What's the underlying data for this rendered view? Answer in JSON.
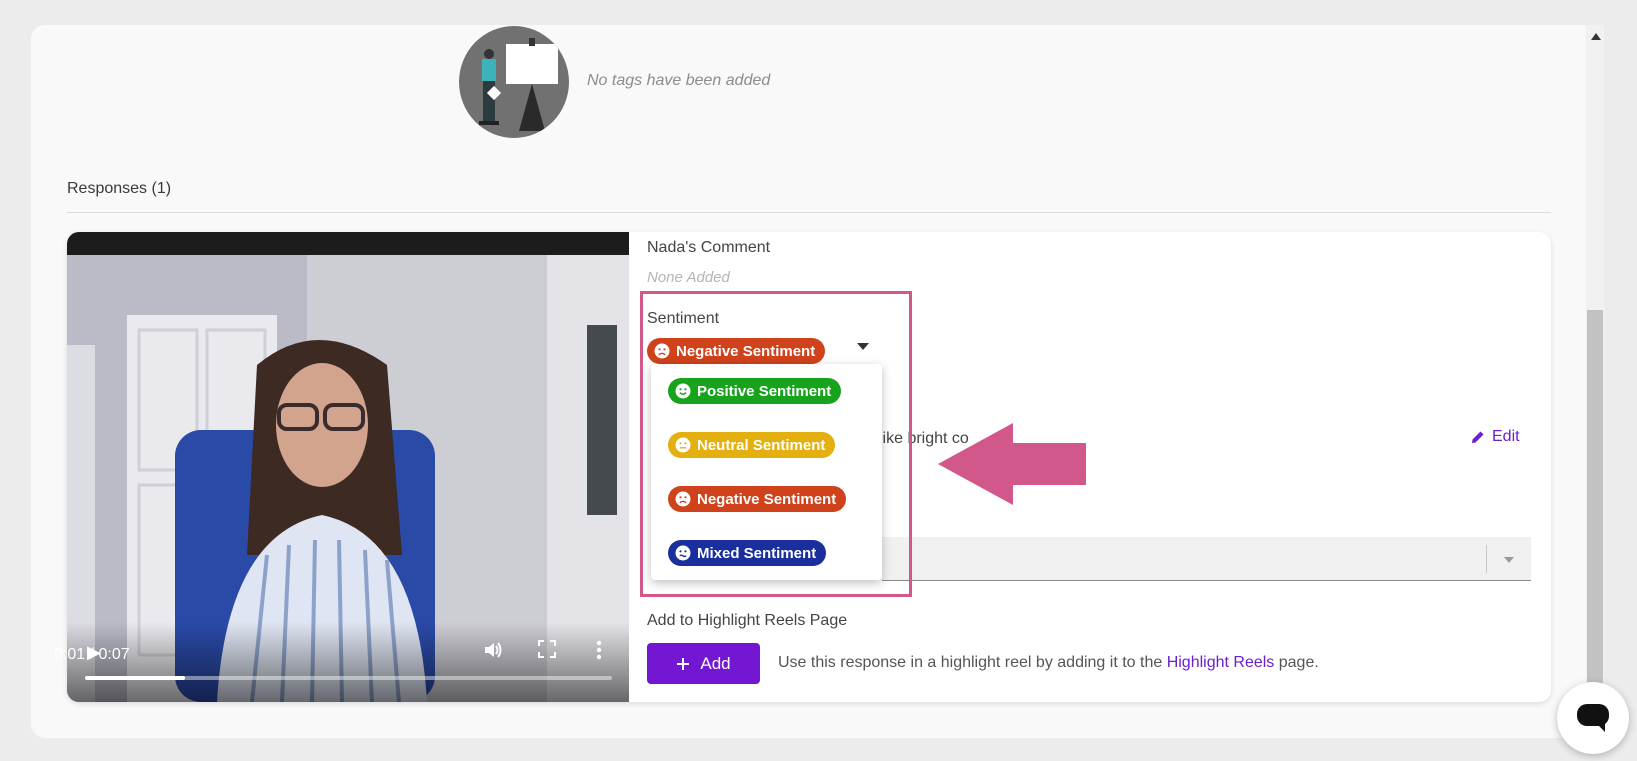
{
  "tags": {
    "empty_text": "No tags have been added"
  },
  "responses": {
    "title": "Responses (1)"
  },
  "video": {
    "time": "0:01 / 0:07",
    "progress": 0.19
  },
  "comment": {
    "label": "Nada's Comment",
    "value": "None Added"
  },
  "sentiment": {
    "label": "Sentiment",
    "selected": "Negative Sentiment",
    "options": [
      {
        "label": "Positive Sentiment",
        "color": "#18a31c"
      },
      {
        "label": "Neutral Sentiment",
        "color": "#e4b00f"
      },
      {
        "label": "Negative Sentiment",
        "color": "#d0421b"
      },
      {
        "label": "Mixed Sentiment",
        "color": "#1a2e9e"
      }
    ]
  },
  "transcript": {
    "visible_fragment": "like bright co",
    "edit_label": "Edit"
  },
  "highlight": {
    "label": "Add to Highlight Reels Page",
    "add_label": "Add",
    "desc_before": "Use this response in a highlight reel by adding it to the",
    "link_text": "Highlight Reels",
    "desc_after": "page."
  },
  "colors": {
    "accent": "#7417d3",
    "annotation": "#d2578a"
  }
}
